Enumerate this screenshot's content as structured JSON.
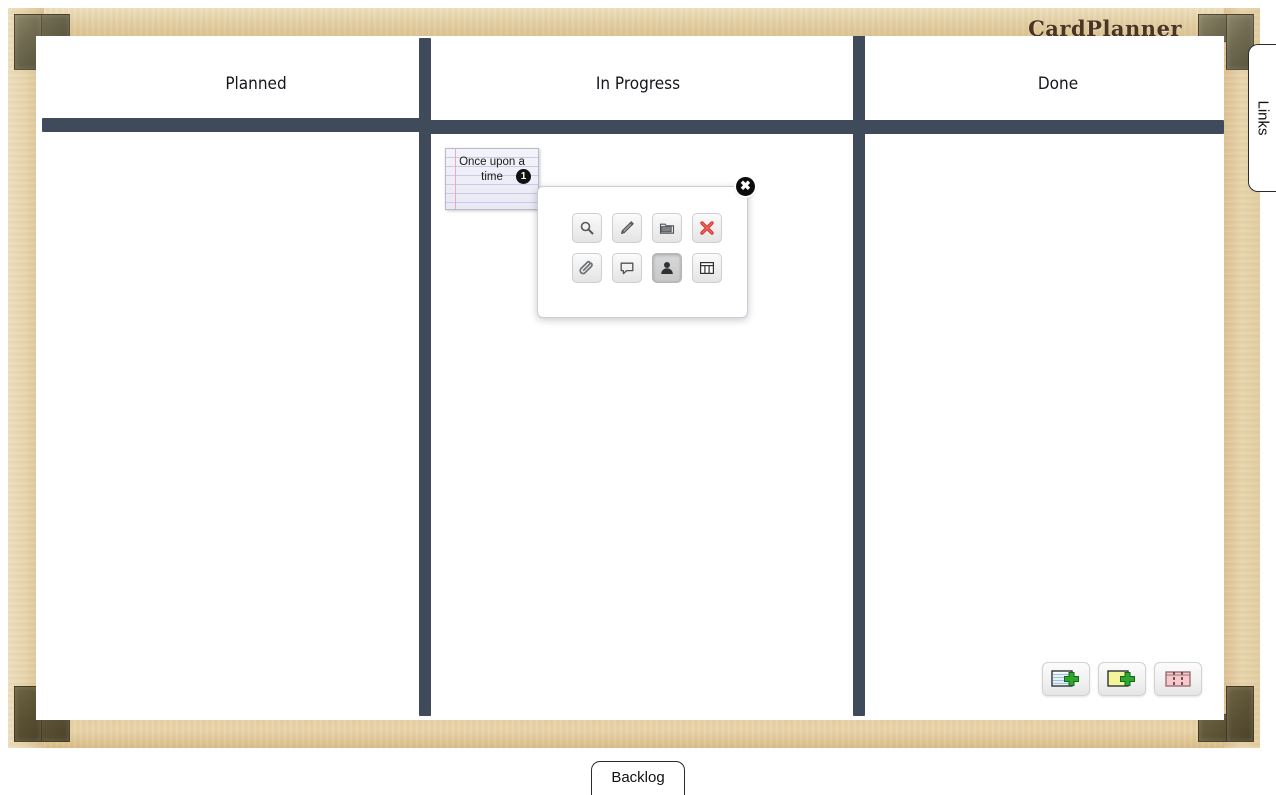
{
  "app": {
    "title": "CardPlanner",
    "frame_wood_color": "#e3cfa4",
    "bracket_color": "#6f6a50",
    "divider_color": "#3f4a5a"
  },
  "board": {
    "columns": [
      {
        "label": "Planned"
      },
      {
        "label": "In Progress"
      },
      {
        "label": "Done"
      }
    ],
    "cards": [
      {
        "title": "Once upon a time",
        "badge": "1",
        "column": "In Progress"
      }
    ]
  },
  "popup": {
    "close_label": "✖",
    "close_icon": "close-icon",
    "rows": [
      [
        {
          "icon": "magnifier-icon",
          "label": "View"
        },
        {
          "icon": "pencil-icon",
          "label": "Edit"
        },
        {
          "icon": "folder-icon",
          "label": "Archive"
        },
        {
          "icon": "red-x-icon",
          "label": "Delete"
        }
      ],
      [
        {
          "icon": "paperclip-icon",
          "label": "Attach"
        },
        {
          "icon": "speech-bubble-icon",
          "label": "Comment"
        },
        {
          "icon": "person-icon",
          "label": "Assign",
          "pressed": true
        },
        {
          "icon": "table-icon",
          "label": "Table"
        }
      ]
    ]
  },
  "actions": [
    {
      "icon": "add-card-icon",
      "label": "Add card"
    },
    {
      "icon": "add-note-icon",
      "label": "Add note"
    },
    {
      "icon": "add-column-icon",
      "label": "Add column"
    }
  ],
  "tabs": {
    "links_label": "Links",
    "backlog_label": "Backlog"
  }
}
